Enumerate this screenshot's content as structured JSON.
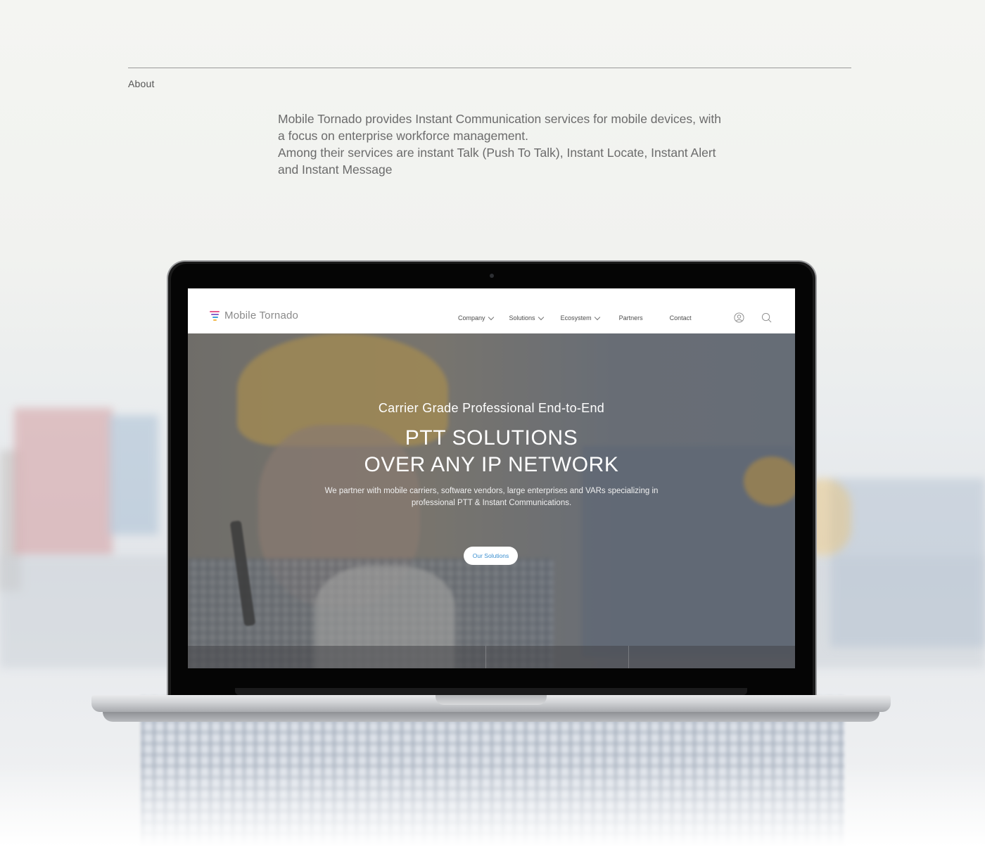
{
  "about": {
    "label": "About",
    "paragraph_1": "Mobile Tornado provides Instant Communication services for mobile devices, with a focus on enterprise workforce management.",
    "paragraph_2": "Among their services are instant Talk (Push To Talk), Instant Locate, Instant Alert and Instant Message"
  },
  "site": {
    "logo_text": "Mobile Tornado",
    "nav": {
      "company": "Company",
      "solutions": "Solutions",
      "ecosystem": "Ecosystem",
      "partners": "Partners",
      "contact": "Contact"
    },
    "icons": [
      "user-icon",
      "search-icon"
    ],
    "hero": {
      "subtitle": "Carrier Grade Professional End-to-End",
      "title_line_1": "PTT SOLUTIONS",
      "title_line_2": "OVER ANY IP NETWORK",
      "description": "We partner with mobile carriers, software vendors, large enterprises and VARs specializing in professional PTT & Instant Communications.",
      "cta_label": "Our Solutions"
    }
  },
  "colors": {
    "accent": "#3a8fd0",
    "logo_pink": "#e45a8c",
    "logo_purple": "#8a63c9",
    "logo_blue": "#3fa0d8",
    "logo_yellow": "#f2b84b"
  }
}
